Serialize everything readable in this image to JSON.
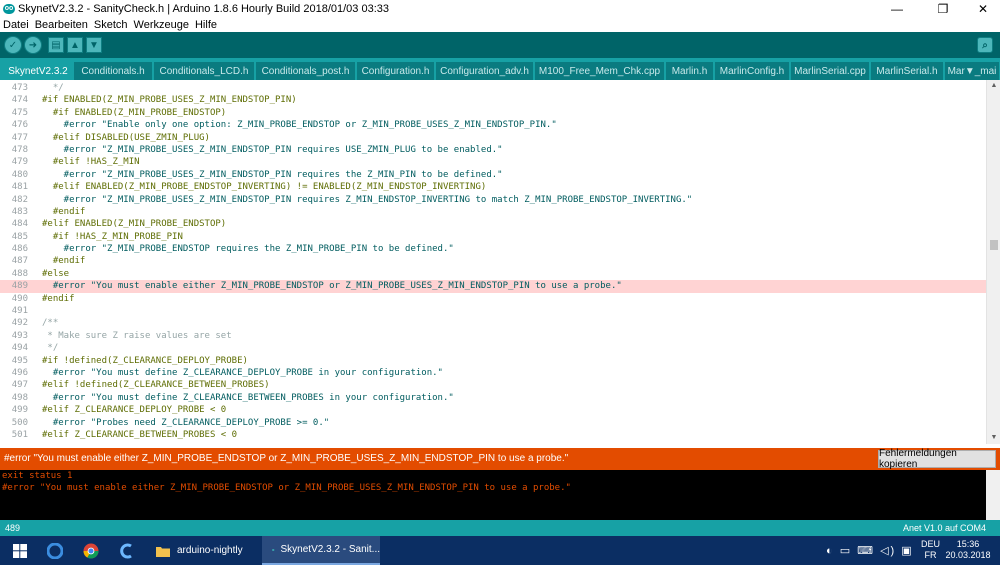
{
  "window": {
    "title": "SkynetV2.3.2 - SanityCheck.h | Arduino 1.8.6 Hourly Build 2018/01/03 03:33",
    "logo_text": "oo",
    "minimize": "—",
    "maximize": "❐",
    "close": "✕"
  },
  "menu": [
    "Datei",
    "Bearbeiten",
    "Sketch",
    "Werkzeuge",
    "Hilfe"
  ],
  "toolbar": {
    "verify_glyph": "✓",
    "upload_glyph": "➜",
    "new_glyph": "▤",
    "open_glyph": "▲",
    "save_glyph": "▼",
    "serial_glyph": "⌕"
  },
  "tabs": [
    "SkynetV2.3.2",
    "Conditionals.h",
    "Conditionals_LCD.h",
    "Conditionals_post.h",
    "Configuration.h",
    "Configuration_adv.h",
    "M100_Free_Mem_Chk.cpp",
    "Marlin.h",
    "MarlinConfig.h",
    "MarlinSerial.cpp",
    "MarlinSerial.h",
    "Mar▼_mai"
  ],
  "code_lines": [
    {
      "n": "473",
      "t": "  */"
    },
    {
      "n": "474",
      "t": "#if ENABLED(Z_MIN_PROBE_USES_Z_MIN_ENDSTOP_PIN)"
    },
    {
      "n": "475",
      "t": "  #if ENABLED(Z_MIN_PROBE_ENDSTOP)"
    },
    {
      "n": "476",
      "t": "    #error \"Enable only one option: Z_MIN_PROBE_ENDSTOP or Z_MIN_PROBE_USES_Z_MIN_ENDSTOP_PIN.\""
    },
    {
      "n": "477",
      "t": "  #elif DISABLED(USE_ZMIN_PLUG)"
    },
    {
      "n": "478",
      "t": "    #error \"Z_MIN_PROBE_USES_Z_MIN_ENDSTOP_PIN requires USE_ZMIN_PLUG to be enabled.\""
    },
    {
      "n": "479",
      "t": "  #elif !HAS_Z_MIN"
    },
    {
      "n": "480",
      "t": "    #error \"Z_MIN_PROBE_USES_Z_MIN_ENDSTOP_PIN requires the Z_MIN_PIN to be defined.\""
    },
    {
      "n": "481",
      "t": "  #elif ENABLED(Z_MIN_PROBE_ENDSTOP_INVERTING) != ENABLED(Z_MIN_ENDSTOP_INVERTING)"
    },
    {
      "n": "482",
      "t": "    #error \"Z_MIN_PROBE_USES_Z_MIN_ENDSTOP_PIN requires Z_MIN_ENDSTOP_INVERTING to match Z_MIN_PROBE_ENDSTOP_INVERTING.\""
    },
    {
      "n": "483",
      "t": "  #endif"
    },
    {
      "n": "484",
      "t": "#elif ENABLED(Z_MIN_PROBE_ENDSTOP)"
    },
    {
      "n": "485",
      "t": "  #if !HAS_Z_MIN_PROBE_PIN"
    },
    {
      "n": "486",
      "t": "    #error \"Z_MIN_PROBE_ENDSTOP requires the Z_MIN_PROBE_PIN to be defined.\""
    },
    {
      "n": "487",
      "t": "  #endif"
    },
    {
      "n": "488",
      "t": "#else"
    },
    {
      "n": "489",
      "t": "  #error \"You must enable either Z_MIN_PROBE_ENDSTOP or Z_MIN_PROBE_USES_Z_MIN_ENDSTOP_PIN to use a probe.\"",
      "hl": true
    },
    {
      "n": "490",
      "t": "#endif"
    },
    {
      "n": "491",
      "t": ""
    },
    {
      "n": "492",
      "t": "/**"
    },
    {
      "n": "493",
      "t": " * Make sure Z raise values are set"
    },
    {
      "n": "494",
      "t": " */"
    },
    {
      "n": "495",
      "t": "#if !defined(Z_CLEARANCE_DEPLOY_PROBE)"
    },
    {
      "n": "496",
      "t": "  #error \"You must define Z_CLEARANCE_DEPLOY_PROBE in your configuration.\""
    },
    {
      "n": "497",
      "t": "#elif !defined(Z_CLEARANCE_BETWEEN_PROBES)"
    },
    {
      "n": "498",
      "t": "  #error \"You must define Z_CLEARANCE_BETWEEN_PROBES in your configuration.\""
    },
    {
      "n": "499",
      "t": "#elif Z_CLEARANCE_DEPLOY_PROBE < 0"
    },
    {
      "n": "500",
      "t": "  #error \"Probes need Z_CLEARANCE_DEPLOY_PROBE >= 0.\""
    },
    {
      "n": "501",
      "t": "#elif Z_CLEARANCE_BETWEEN_PROBES < 0"
    }
  ],
  "scroll_arrows": {
    "up": "▲",
    "down": "▼"
  },
  "error_bar": {
    "message": "#error \"You must enable either Z_MIN_PROBE_ENDSTOP or Z_MIN_PROBE_USES_Z_MIN_ENDSTOP_PIN to use a probe.\"",
    "copy_button": "Fehlermeldungen kopieren"
  },
  "console": [
    "exit status 1",
    "#error \"You must enable either Z_MIN_PROBE_ENDSTOP or Z_MIN_PROBE_USES_Z_MIN_ENDSTOP_PIN to use a probe.\""
  ],
  "status": {
    "line": "489",
    "board": "Anet V1.0 auf COM4"
  },
  "taskbar": {
    "start_icon": "windows-icon",
    "items": [
      {
        "label": "arduino-nightly",
        "icon": "folder-icon"
      },
      {
        "label": "SkynetV2.3.2 - Sanit...",
        "icon": "arduino-icon"
      }
    ],
    "tray_icons": "◐ ▭ ⌨ ◁) ▣",
    "lang_top": "DEU",
    "lang_bottom": "FR",
    "time": "15:36",
    "date": "20.03.2018"
  },
  "colors": {
    "toolbar": "#006468",
    "tabs": "#17a1a5",
    "error": "#e34c00",
    "highlight": "#ffd3d3",
    "taskbar": "#0b2e63"
  }
}
